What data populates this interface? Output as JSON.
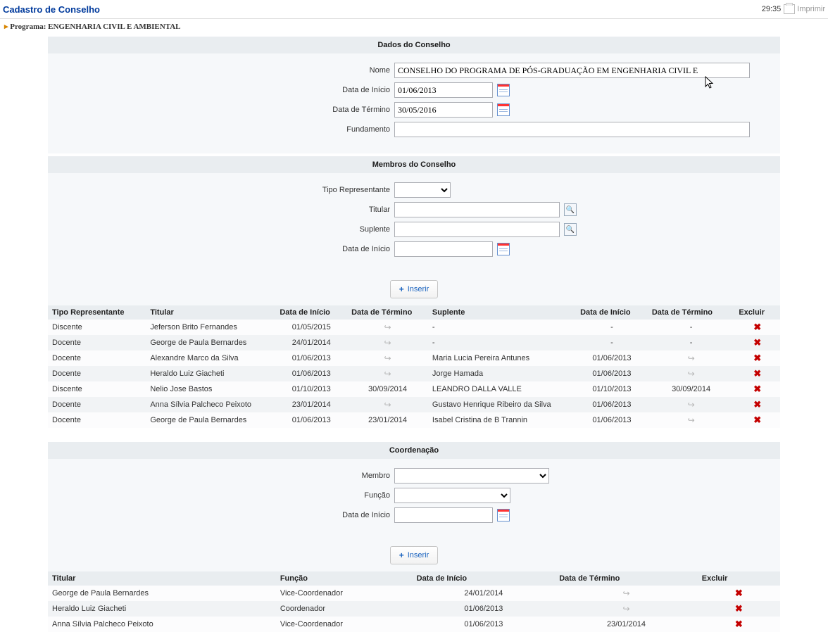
{
  "header": {
    "title": "Cadastro de Conselho",
    "time": "29:35",
    "print_label": "Imprimir"
  },
  "programa": {
    "prefix": "▸",
    "label": "Programa: ENGENHARIA CIVIL E AMBIENTAL"
  },
  "dados": {
    "section_title": "Dados do Conselho",
    "labels": {
      "nome": "Nome",
      "data_inicio": "Data de Início",
      "data_termino": "Data de Término",
      "fundamento": "Fundamento"
    },
    "values": {
      "nome": "CONSELHO DO PROGRAMA DE PÓS-GRADUAÇÃO EM ENGENHARIA CIVIL E",
      "data_inicio": "01/06/2013",
      "data_termino": "30/05/2016",
      "fundamento": ""
    }
  },
  "membros": {
    "section_title": "Membros do Conselho",
    "labels": {
      "tipo": "Tipo Representante",
      "titular": "Titular",
      "suplente": "Suplente",
      "data_inicio": "Data de Início"
    },
    "insert_label": "Inserir",
    "columns": [
      "Tipo Representante",
      "Titular",
      "Data de Início",
      "Data de Término",
      "Suplente",
      "Data de Início",
      "Data de Término",
      "Excluir"
    ],
    "rows": [
      {
        "tipo": "Discente",
        "titular": "Jeferson Brito Fernandes",
        "d1": "01/05/2015",
        "d2": "arrow",
        "suplente": "-",
        "s1": "-",
        "s2": "-"
      },
      {
        "tipo": "Docente",
        "titular": "George de Paula Bernardes",
        "d1": "24/01/2014",
        "d2": "arrow",
        "suplente": "-",
        "s1": "-",
        "s2": "-"
      },
      {
        "tipo": "Docente",
        "titular": "Alexandre Marco da Silva",
        "d1": "01/06/2013",
        "d2": "arrow",
        "suplente": "Maria Lucia Pereira Antunes",
        "s1": "01/06/2013",
        "s2": "arrow"
      },
      {
        "tipo": "Docente",
        "titular": "Heraldo Luiz Giacheti",
        "d1": "01/06/2013",
        "d2": "arrow",
        "suplente": "Jorge Hamada",
        "s1": "01/06/2013",
        "s2": "arrow"
      },
      {
        "tipo": "Discente",
        "titular": "Nelio Jose Bastos",
        "d1": "01/10/2013",
        "d2": "30/09/2014",
        "suplente": "LEANDRO DALLA VALLE",
        "s1": "01/10/2013",
        "s2": "30/09/2014"
      },
      {
        "tipo": "Docente",
        "titular": "Anna Sílvia Palcheco Peixoto",
        "d1": "23/01/2014",
        "d2": "arrow",
        "suplente": "Gustavo Henrique Ribeiro da Silva",
        "s1": "01/06/2013",
        "s2": "arrow"
      },
      {
        "tipo": "Docente",
        "titular": "George de Paula Bernardes",
        "d1": "01/06/2013",
        "d2": "23/01/2014",
        "suplente": "Isabel Cristina de B Trannin",
        "s1": "01/06/2013",
        "s2": "arrow"
      }
    ]
  },
  "coord": {
    "section_title": "Coordenação",
    "labels": {
      "membro": "Membro",
      "funcao": "Função",
      "data_inicio": "Data de Início"
    },
    "insert_label": "Inserir",
    "columns": [
      "Titular",
      "Função",
      "Data de Início",
      "Data de Término",
      "Excluir"
    ],
    "rows": [
      {
        "titular": "George de Paula Bernardes",
        "funcao": "Vice-Coordenador",
        "d1": "24/01/2014",
        "d2": "arrow"
      },
      {
        "titular": "Heraldo Luiz Giacheti",
        "funcao": "Coordenador",
        "d1": "01/06/2013",
        "d2": "arrow"
      },
      {
        "titular": "Anna Sílvia Palcheco Peixoto",
        "funcao": "Vice-Coordenador",
        "d1": "01/06/2013",
        "d2": "23/01/2014"
      }
    ]
  }
}
